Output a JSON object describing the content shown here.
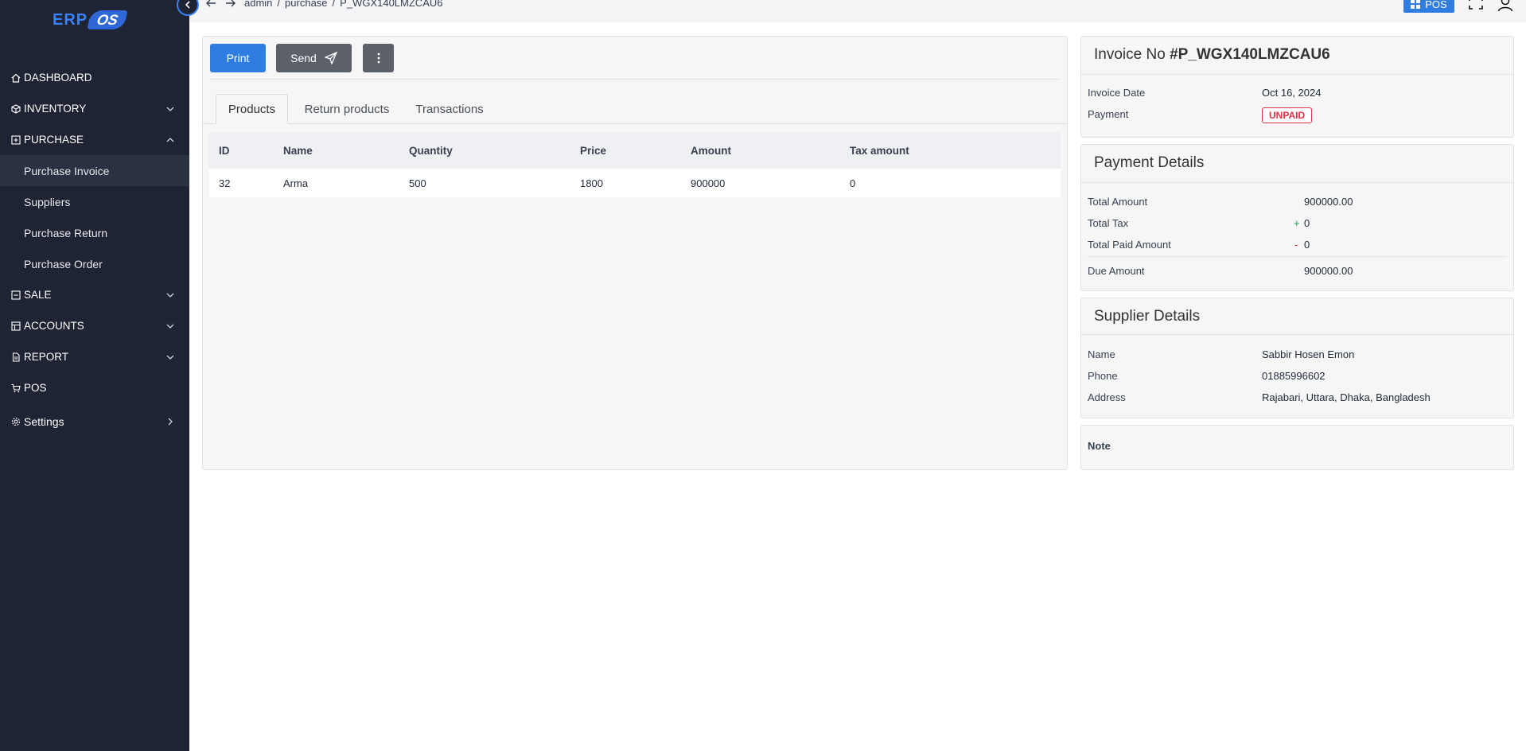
{
  "logo": {
    "erp": "ERP",
    "os": "OS"
  },
  "sidebar": {
    "items": [
      {
        "label": "DASHBOARD",
        "icon": "home-icon"
      },
      {
        "label": "INVENTORY",
        "icon": "box-icon"
      },
      {
        "label": "PURCHASE",
        "icon": "plus-square-icon"
      },
      {
        "label": "SALE",
        "icon": "minus-square-icon"
      },
      {
        "label": "ACCOUNTS",
        "icon": "ledger-icon"
      },
      {
        "label": "REPORT",
        "icon": "file-icon"
      },
      {
        "label": "POS",
        "icon": "cart-icon"
      },
      {
        "label": "Settings",
        "icon": "gear-icon"
      }
    ],
    "purchase_sub": [
      {
        "label": "Purchase Invoice"
      },
      {
        "label": "Suppliers"
      },
      {
        "label": "Purchase Return"
      },
      {
        "label": "Purchase Order"
      }
    ]
  },
  "breadcrumb": {
    "c1": "admin",
    "c2": "purchase",
    "c3": "P_WGX140LMZCAU6",
    "sep": "/"
  },
  "topbar": {
    "pos_label": "POS"
  },
  "toolbar": {
    "print_label": "Print",
    "send_label": "Send"
  },
  "tabs": [
    {
      "label": "Products"
    },
    {
      "label": "Return products"
    },
    {
      "label": "Transactions"
    }
  ],
  "table": {
    "headers": [
      "ID",
      "Name",
      "Quantity",
      "Price",
      "Amount",
      "Tax amount"
    ],
    "rows": [
      [
        "32",
        "Arma",
        "500",
        "1800",
        "900000",
        "0"
      ]
    ]
  },
  "invoice": {
    "title_prefix": "Invoice No",
    "number": "#P_WGX140LMZCAU6",
    "date_label": "Invoice Date",
    "date_value": "Oct 16, 2024",
    "payment_label": "Payment",
    "payment_status": "UNPAID"
  },
  "payment_details": {
    "title": "Payment Details",
    "total_amount_label": "Total Amount",
    "total_amount_value": "900000.00",
    "total_tax_label": "Total Tax",
    "total_tax_sign": "+",
    "total_tax_value": "0",
    "total_paid_label": "Total Paid Amount",
    "total_paid_sign": "-",
    "total_paid_value": "0",
    "due_label": "Due Amount",
    "due_value": "900000.00"
  },
  "supplier": {
    "title": "Supplier Details",
    "name_label": "Name",
    "name_value": "Sabbir Hosen Emon",
    "phone_label": "Phone",
    "phone_value": "01885996602",
    "address_label": "Address",
    "address_value": "Rajabari, Uttara, Dhaka, Bangladesh"
  },
  "note": {
    "label": "Note"
  },
  "colors": {
    "sidebar": "#1e2433",
    "primary": "#2f7de1",
    "secondary": "#5b6069",
    "danger": "#dc3545"
  }
}
